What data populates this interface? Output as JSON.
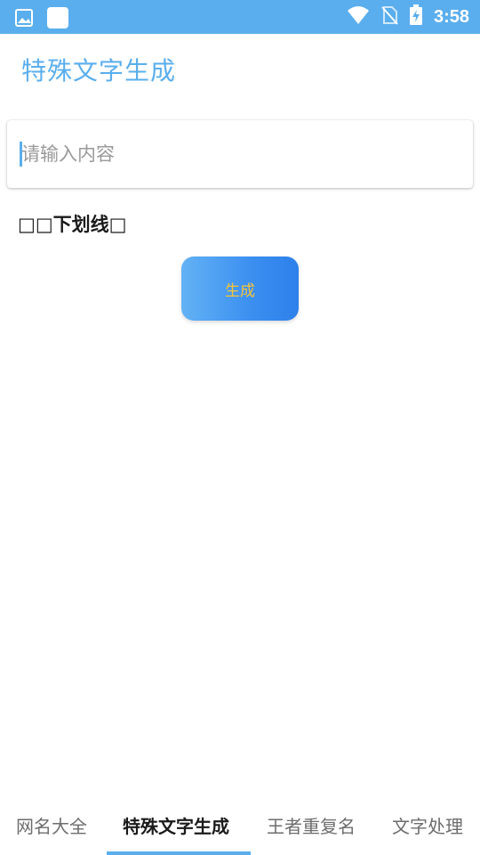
{
  "status_bar": {
    "time": "3:58",
    "left_icons": [
      "image-icon",
      "app-notification-icon"
    ],
    "right_icons": [
      "wifi-icon",
      "no-sim-icon",
      "battery-charging-icon"
    ]
  },
  "app": {
    "title": "特殊文字生成"
  },
  "input": {
    "placeholder": "请输入内容",
    "value": ""
  },
  "style_label": "□□下划线□",
  "generate_button_label": "生成",
  "bottom_tabs": [
    {
      "label": "网名大全",
      "active": false
    },
    {
      "label": "特殊文字生成",
      "active": true
    },
    {
      "label": "王者重复名",
      "active": false
    },
    {
      "label": "文字处理",
      "active": false
    }
  ],
  "colors": {
    "accent": "#5aaeed",
    "button_text": "#f5c53a",
    "button_gradient_start": "#63b2f5",
    "button_gradient_end": "#2d80ea"
  }
}
